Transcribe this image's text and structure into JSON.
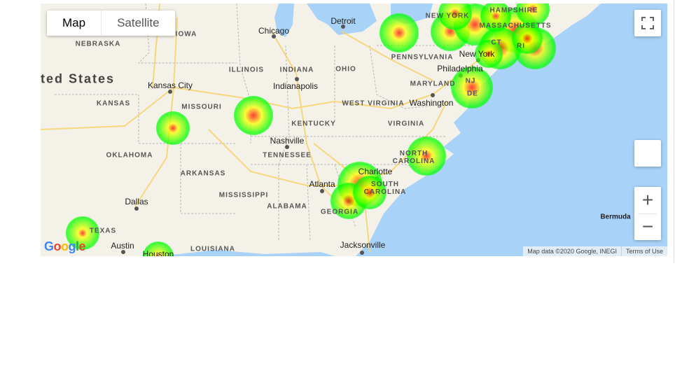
{
  "map_type_control": {
    "map_label": "Map",
    "satellite_label": "Satellite",
    "selected": "Map"
  },
  "controls": {
    "fullscreen_icon": "fullscreen-icon",
    "pegman_icon": "pegman-icon",
    "zoom_in_label": "+",
    "zoom_out_label": "−"
  },
  "attribution": {
    "map_data": "Map data ©2020 Google, INEGI",
    "terms": "Terms of Use",
    "logo": "Google"
  },
  "labels": {
    "country": "ted States",
    "ocean": "Bermuda",
    "states": [
      "NEBRASKA",
      "IOWA",
      "ILLINOIS",
      "INDIANA",
      "OHIO",
      "PENNSYLVANIA",
      "NEW YORK",
      "HAMPSHIRE",
      "MASSACHUSETTS",
      "CT",
      "RI",
      "NJ",
      "MARYLAND",
      "DE",
      "WEST VIRGINIA",
      "VIRGINIA",
      "KANSAS",
      "MISSOURI",
      "KENTUCKY",
      "TENNESSEE",
      "NORTH CAROLINA",
      "SOUTH CAROLINA",
      "OKLAHOMA",
      "ARKANSAS",
      "MISSISSIPPI",
      "ALABAMA",
      "GEORGIA",
      "TEXAS",
      "LOUISIANA"
    ],
    "cities": [
      "Chicago",
      "Detroit",
      "Kansas City",
      "Indianapolis",
      "Washington",
      "Philadelphia",
      "New York",
      "Nashville",
      "Charlotte",
      "Atlanta",
      "Dallas",
      "Austin",
      "Houston",
      "Jacksonville"
    ]
  },
  "heatmap": {
    "gradient": [
      "#00ff00",
      "#ffff00",
      "#ff0000"
    ],
    "point_count": 20
  },
  "colors": {
    "water": "#a8d2f7",
    "land": "#f3f1e8",
    "road": "#f7d36b",
    "border": "#9e9e9e"
  }
}
